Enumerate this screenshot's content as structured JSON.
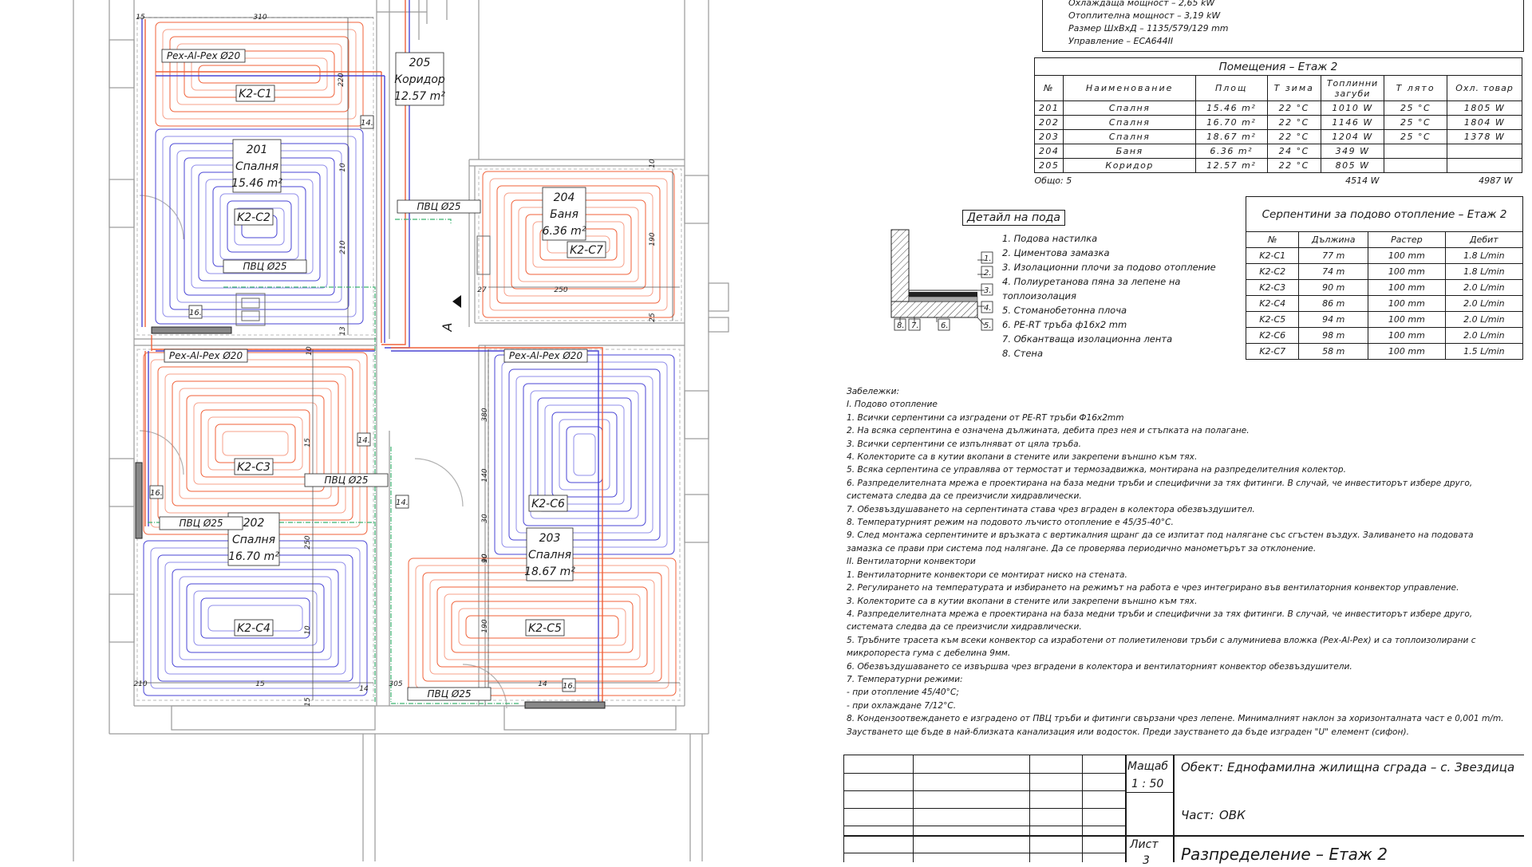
{
  "plan": {
    "rooms": [
      {
        "id": "room-201",
        "number": "201",
        "name": "Спалня",
        "area": "15.46 m²"
      },
      {
        "id": "room-202",
        "number": "202",
        "name": "Спалня",
        "area": "16.70 m²"
      },
      {
        "id": "room-203",
        "number": "203",
        "name": "Спалня",
        "area": "18.67 m²"
      },
      {
        "id": "room-204",
        "number": "204",
        "name": "Баня",
        "area": "6.36 m²"
      },
      {
        "id": "room-205",
        "number": "205",
        "name": "Коридор",
        "area": "12.57 m²"
      }
    ],
    "coils": [
      "K2-C1",
      "K2-C2",
      "K2-C3",
      "K2-C4",
      "K2-C5",
      "K2-C6",
      "K2-C7"
    ],
    "pipe_labels": [
      "Pex-Al-Pex Ø20",
      "Pex-Al-Pex Ø20",
      "Pex-Al-Pex Ø20",
      "ПВЦ Ø25",
      "ПВЦ Ø25",
      "ПВЦ Ø25",
      "ПВЦ Ø25",
      "ПВЦ Ø25"
    ],
    "tags": [
      "14.",
      "14.",
      "14.",
      "16.",
      "16.",
      "16."
    ],
    "dims": [
      "15",
      "310",
      "220",
      "10",
      "210",
      "13",
      "27",
      "250",
      "190",
      "10",
      "25",
      "10",
      "15",
      "250",
      "10",
      "210",
      "15",
      "305",
      "14",
      "380",
      "140",
      "30",
      "90",
      "10",
      "190",
      "15",
      "14"
    ],
    "section_mark": "A",
    "colors": {
      "supply": "#f0623a",
      "return": "#4a46d6",
      "drain": "#3cb371",
      "wall": "#9a9a9a"
    }
  },
  "spec": {
    "lines": [
      "Охлаждаща мощност – 2,65 kW",
      "Отоплителна мощност – 3,19 kW",
      "Размер ШхВхД – 1135/579/129 mm",
      "Управление – ECA644II"
    ]
  },
  "rooms_table": {
    "title": "Помещения – Етаж 2",
    "headers": [
      "№",
      "Наименование",
      "Площ",
      "Т зима",
      "Топлинни загуби",
      "Т лято",
      "Охл. товар"
    ],
    "rows": [
      [
        "201",
        "Спалня",
        "15.46 m²",
        "22 °C",
        "1010 W",
        "25 °C",
        "1805 W"
      ],
      [
        "202",
        "Спалня",
        "16.70 m²",
        "22 °C",
        "1146 W",
        "25 °C",
        "1804 W"
      ],
      [
        "203",
        "Спалня",
        "18.67 m²",
        "22 °C",
        "1204 W",
        "25 °C",
        "1378 W"
      ],
      [
        "204",
        "Баня",
        "6.36 m²",
        "24 °C",
        "349 W",
        "",
        ""
      ],
      [
        "205",
        "Коридор",
        "12.57 m²",
        "22 °C",
        "805 W",
        "",
        ""
      ]
    ],
    "total_label": "Общо: 5",
    "total_losses": "4514 W",
    "total_cooling": "4987 W"
  },
  "detail": {
    "title": "Детайл на пода",
    "items": [
      "1. Подова настилка",
      "2. Циментова замазка",
      "3. Изолационни плочи за подово отопление",
      "4. Полиуретанова пяна за лепене на",
      "топлоизолация",
      "5. Стоманобетонна плоча",
      "6. PE-RT тръба ф16х2 mm",
      "7. Обкантваща изолационна лента",
      "8. Стена"
    ],
    "markers": [
      "1.",
      "2.",
      "3.",
      "4.",
      "5.",
      "6.",
      "7.",
      "8."
    ]
  },
  "coils_table": {
    "title": "Серпентини за подово отопление – Етаж 2",
    "headers": [
      "№",
      "Дължина",
      "Растер",
      "Дебит"
    ],
    "rows": [
      [
        "K2-C1",
        "77 m",
        "100 mm",
        "1.8 L/min"
      ],
      [
        "K2-C2",
        "74 m",
        "100 mm",
        "1.8 L/min"
      ],
      [
        "K2-C3",
        "90 m",
        "100 mm",
        "2.0 L/min"
      ],
      [
        "K2-C4",
        "86 m",
        "100 mm",
        "2.0 L/min"
      ],
      [
        "K2-C5",
        "94 m",
        "100 mm",
        "2.0 L/min"
      ],
      [
        "K2-C6",
        "98 m",
        "100 mm",
        "2.0 L/min"
      ],
      [
        "K2-C7",
        "58 m",
        "100 mm",
        "1.5 L/min"
      ]
    ]
  },
  "notes": [
    "Забележки:",
    "I. Подово отопление",
    "1. Всички серпентини са изградени от PE-RT тръби Ф16х2mm",
    "2. На всяка серпентина е означена дължината, дебита през нея и стъпката на полагане.",
    "3. Всички серпентини се изпълняват от цяла тръба.",
    "4. Колекторите са в кутии вкопани в стените или закрепени външно към тях.",
    "5. Всяка серпентина се управлява от термостат и термозадвижка, монтирана на разпределителния колектор.",
    "6. Разпределителната мрежа е проектирана на база медни тръби и специфични за тях фитинги. В случай, че инвеститорът избере друго,",
    "системата следва да се преизчисли хидравлически.",
    "7. Обезвъздушаването на серпентината става чрез вграден в колектора обезвъздушител.",
    "8. Температурният режим на подовото лъчисто отопление е 45/35-40°С.",
    "9. След монтажа серпентините и връзката с вертикалния щранг да се изпитат под налягане със сгъстен въздух. Заливането на подовата",
    "замазка се прави при система под налягане. Да се проверява периодично манометърът за отклонение.",
    "II. Вентилаторни конвектори",
    "1. Вентилаторните конвектори се монтират ниско на стената.",
    "2. Регулирането на температурата и избирането на режимът на работа е чрез интегрирано във вентилаторния конвектор управление.",
    "3. Колекторите са в кутии вкопани в стените или закрепени външно към тях.",
    "4. Разпределителната мрежа е проектирана на база медни тръби и специфични за тях фитинги. В случай, че инвеститорът избере друго,",
    "системата следва да се преизчисли хидравлически.",
    "5. Тръбните трасета към всеки конвектор са изработени от полиетиленови тръби с алуминиева вложка (Pex-Al-Pex) и са топлоизолирани с",
    "микропореста гума с дебелина 9мм.",
    "6. Обезвъздушаването се извършва чрез вградени в колектора и вентилаторният конвектор обезвъздушители.",
    "7. Температурни режими:",
    "- при отопление  45/40°С;",
    "- при охлаждане 7/12°С.",
    "8. Кондензоотвеждането е изградено от ПВЦ тръби и фитинги свързани чрез лепене. Минималният наклон за хоризонталната част е 0,001 m/m.",
    "Заустването ще бъде в най-близката канализация или водосток. Преди заустването да бъде изграден \"U\" елемент (сифон)."
  ],
  "title_block": {
    "scale_label": "Мащаб",
    "scale_value": "1 : 50",
    "object_label": "Обект:",
    "object_value": "Еднофамилна жилищна сграда – с. Звездица",
    "part_label": "Част:",
    "part_value": "ОВК",
    "sheet_label": "Лист",
    "sheet_value": "3",
    "sheet_title": "Разпределение – Етаж 2"
  }
}
